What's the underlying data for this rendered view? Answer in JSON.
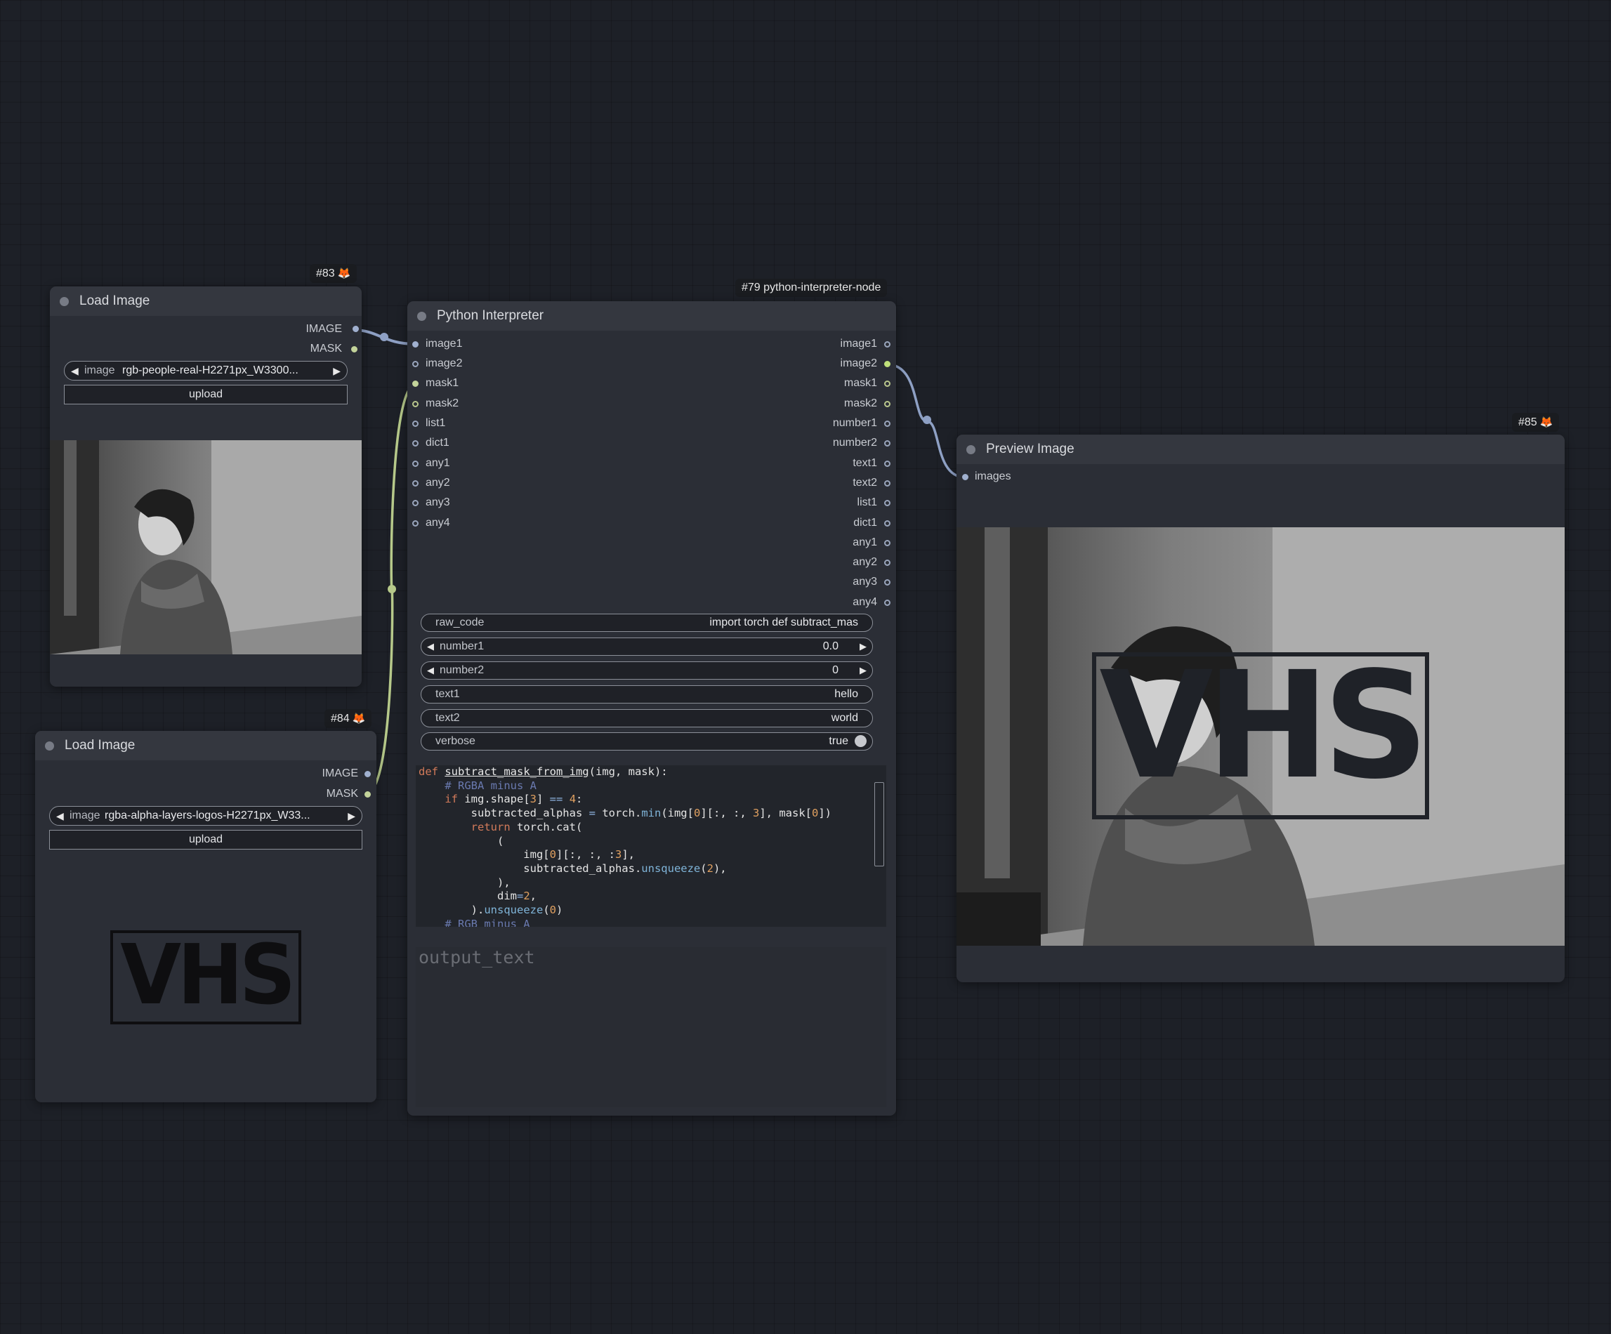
{
  "nodes": {
    "load_image_1": {
      "badge": "#83",
      "title": "Load Image",
      "outputs": [
        "IMAGE",
        "MASK"
      ],
      "image_label": "image",
      "image_value": "rgb-people-real-H2271px_W3300...",
      "upload_label": "upload"
    },
    "load_image_2": {
      "badge": "#84",
      "title": "Load Image",
      "outputs": [
        "IMAGE",
        "MASK"
      ],
      "image_label": "image",
      "image_value": "rgba-alpha-layers-logos-H2271px_W33...",
      "upload_label": "upload",
      "logo_text": "VHS"
    },
    "python": {
      "badge": "#79 python-interpreter-node",
      "title": "Python Interpreter",
      "inputs": [
        "image1",
        "image2",
        "mask1",
        "mask2",
        "list1",
        "dict1",
        "any1",
        "any2",
        "any3",
        "any4"
      ],
      "outputs": [
        "image1",
        "image2",
        "mask1",
        "mask2",
        "number1",
        "number2",
        "text1",
        "text2",
        "list1",
        "dict1",
        "any1",
        "any2",
        "any3",
        "any4"
      ],
      "widgets": {
        "raw_code": {
          "label": "raw_code",
          "value": "import torch  def subtract_mas"
        },
        "number1": {
          "label": "number1",
          "value": "0.0"
        },
        "number2": {
          "label": "number2",
          "value": "0"
        },
        "text1": {
          "label": "text1",
          "value": "hello"
        },
        "text2": {
          "label": "text2",
          "value": "world"
        },
        "verbose": {
          "label": "verbose",
          "value": "true"
        }
      },
      "code_lines": [
        "def subtract_mask_from_img(img, mask):",
        "    # RGBA minus A",
        "    if img.shape[3] == 4:",
        "        subtracted_alphas = torch.min(img[0][:, :, 3], mask[0])",
        "        return torch.cat(",
        "            (",
        "                img[0][:, :, :3],",
        "                subtracted_alphas.unsqueeze(2),",
        "            ),",
        "            dim=2,",
        "        ).unsqueeze(0)",
        "    # RGB minus A"
      ],
      "output_placeholder": "output_text"
    },
    "preview": {
      "badge": "#85",
      "title": "Preview Image",
      "input": "images",
      "logo_text": "VHS"
    }
  },
  "colors": {
    "background": "#1d2027",
    "node_body": "#2b2e36",
    "node_title": "#34373f",
    "image_wire": "#8ea0c4",
    "mask_wire": "#b6c98a",
    "badge_icon": "#f08a24"
  }
}
